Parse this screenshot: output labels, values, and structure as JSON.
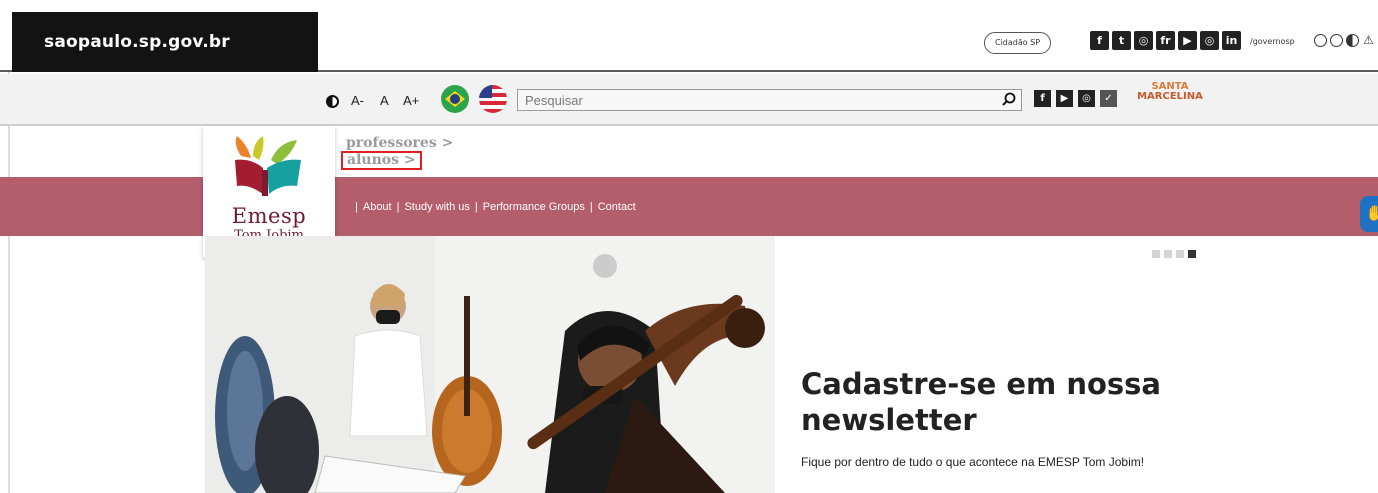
{
  "gov_bar": {
    "logo_text": "saopaulo.sp.gov.br",
    "cidadao_label": "Cidadão SP",
    "social_icons": [
      {
        "icon": "facebook-icon",
        "glyph": "f"
      },
      {
        "icon": "twitter-icon",
        "glyph": "t"
      },
      {
        "icon": "instagram-icon",
        "glyph": "◎"
      },
      {
        "icon": "flickr-icon",
        "glyph": "fr"
      },
      {
        "icon": "youtube-icon",
        "glyph": "▶"
      },
      {
        "icon": "issuu-icon",
        "glyph": "◎"
      },
      {
        "icon": "linkedin-icon",
        "glyph": "in"
      }
    ],
    "handle": "/governosp"
  },
  "tools_bar": {
    "font_decrease": "A-",
    "font_normal": "A",
    "font_increase": "A+",
    "search_placeholder": "Pesquisar",
    "social_icons": [
      {
        "icon": "facebook-icon",
        "glyph": "f"
      },
      {
        "icon": "youtube-icon",
        "glyph": "▶"
      },
      {
        "icon": "instagram-icon",
        "glyph": "◎"
      },
      {
        "icon": "twitter-icon",
        "glyph": "✓"
      }
    ],
    "partner_line1": "SANTA",
    "partner_line2": "MARCELINA"
  },
  "breadcrumbs": {
    "professores": "professores >",
    "alunos": "alunos >"
  },
  "logo": {
    "name": "Emesp",
    "sub": "Tom Jobim"
  },
  "nav": {
    "items": [
      "About",
      "Study with us",
      "Performance Groups",
      "Contact"
    ]
  },
  "slider": {
    "count": 4,
    "active_index": 3
  },
  "newsletter": {
    "title": "Cadastre-se em nossa newsletter",
    "text": "Fique por dentro de tudo o que acontece na EMESP Tom Jobim!"
  },
  "colors": {
    "nav_band": "#b45e6c",
    "logo_text": "#6b1c30",
    "highlight_box": "#e02020"
  }
}
